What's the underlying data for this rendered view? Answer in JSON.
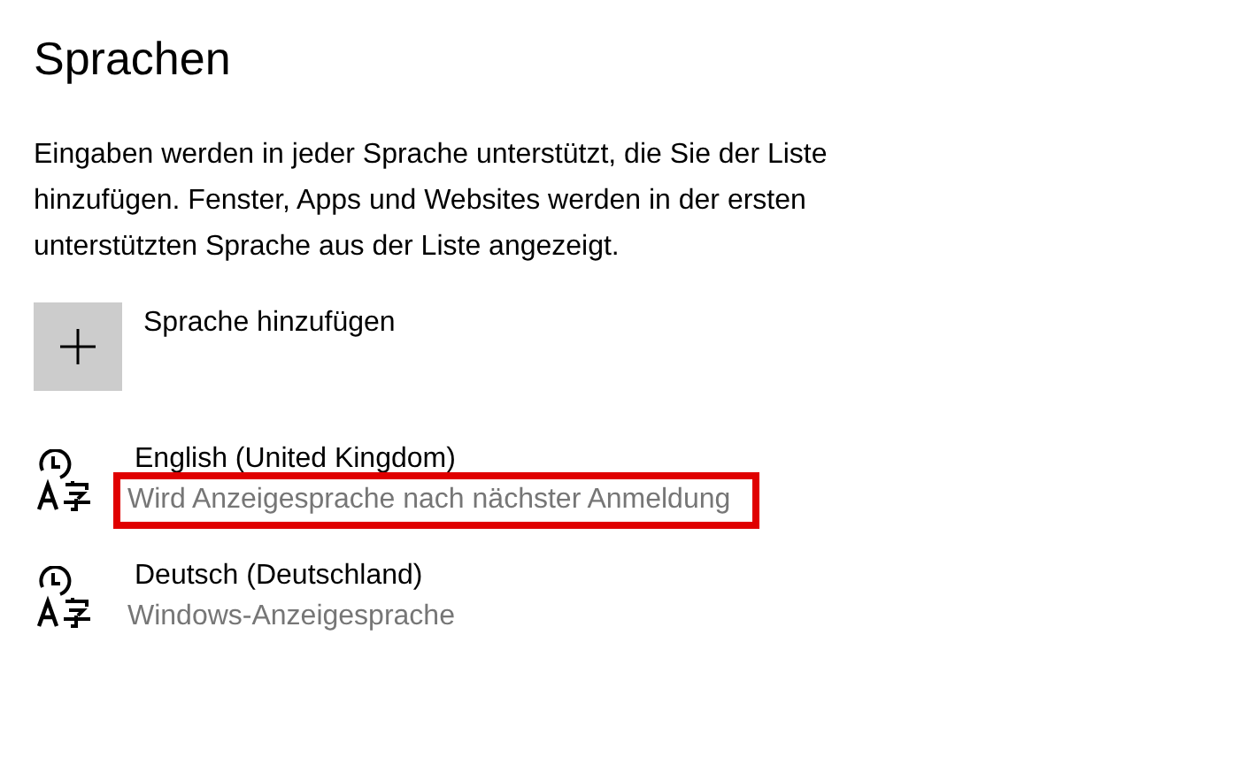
{
  "title": "Sprachen",
  "description": "Eingaben werden in jeder Sprache unterstützt, die Sie der Liste hinzufügen. Fenster, Apps und Websites werden in der ersten unterstützten Sprache aus der Liste angezeigt.",
  "add_button": {
    "label": "Sprache hinzufügen"
  },
  "languages": [
    {
      "name": "English (United Kingdom)",
      "status": "Wird Anzeigesprache nach nächster Anmeldung",
      "highlighted": true
    },
    {
      "name": "Deutsch (Deutschland)",
      "status": "Windows-Anzeigesprache",
      "highlighted": false
    }
  ]
}
